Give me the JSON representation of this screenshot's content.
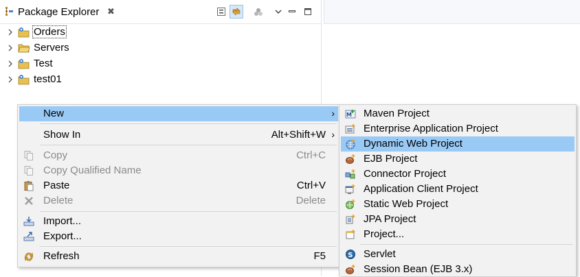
{
  "view": {
    "title": "Package Explorer",
    "close_glyph": "✖"
  },
  "tree": [
    {
      "label": "Orders",
      "icon": "project-icon"
    },
    {
      "label": "Servers",
      "icon": "folder-icon"
    },
    {
      "label": "Test",
      "icon": "project-icon"
    },
    {
      "label": "test01",
      "icon": "project-icon"
    }
  ],
  "context_menu": {
    "new": {
      "label": "New",
      "arrow": "›"
    },
    "show_in": {
      "label": "Show In",
      "shortcut": "Alt+Shift+W",
      "arrow": "›"
    },
    "copy": {
      "label": "Copy",
      "shortcut": "Ctrl+C"
    },
    "copy_qualified": {
      "label": "Copy Qualified Name"
    },
    "paste": {
      "label": "Paste",
      "shortcut": "Ctrl+V"
    },
    "delete": {
      "label": "Delete",
      "shortcut": "Delete"
    },
    "import": {
      "label": "Import..."
    },
    "export": {
      "label": "Export..."
    },
    "refresh": {
      "label": "Refresh",
      "shortcut": "F5"
    }
  },
  "submenu": [
    {
      "label": "Maven Project"
    },
    {
      "label": "Enterprise Application Project"
    },
    {
      "label": "Dynamic Web Project"
    },
    {
      "label": "EJB Project"
    },
    {
      "label": "Connector Project"
    },
    {
      "label": "Application Client Project"
    },
    {
      "label": "Static Web Project"
    },
    {
      "label": "JPA Project"
    },
    {
      "label": "Project..."
    },
    {
      "label": "Servlet"
    },
    {
      "label": "Session Bean (EJB 3.x)"
    }
  ],
  "colors": {
    "highlight": "#99c9f5",
    "menu_bg": "#f2f2f2",
    "disabled_text": "#8a8a8a"
  }
}
